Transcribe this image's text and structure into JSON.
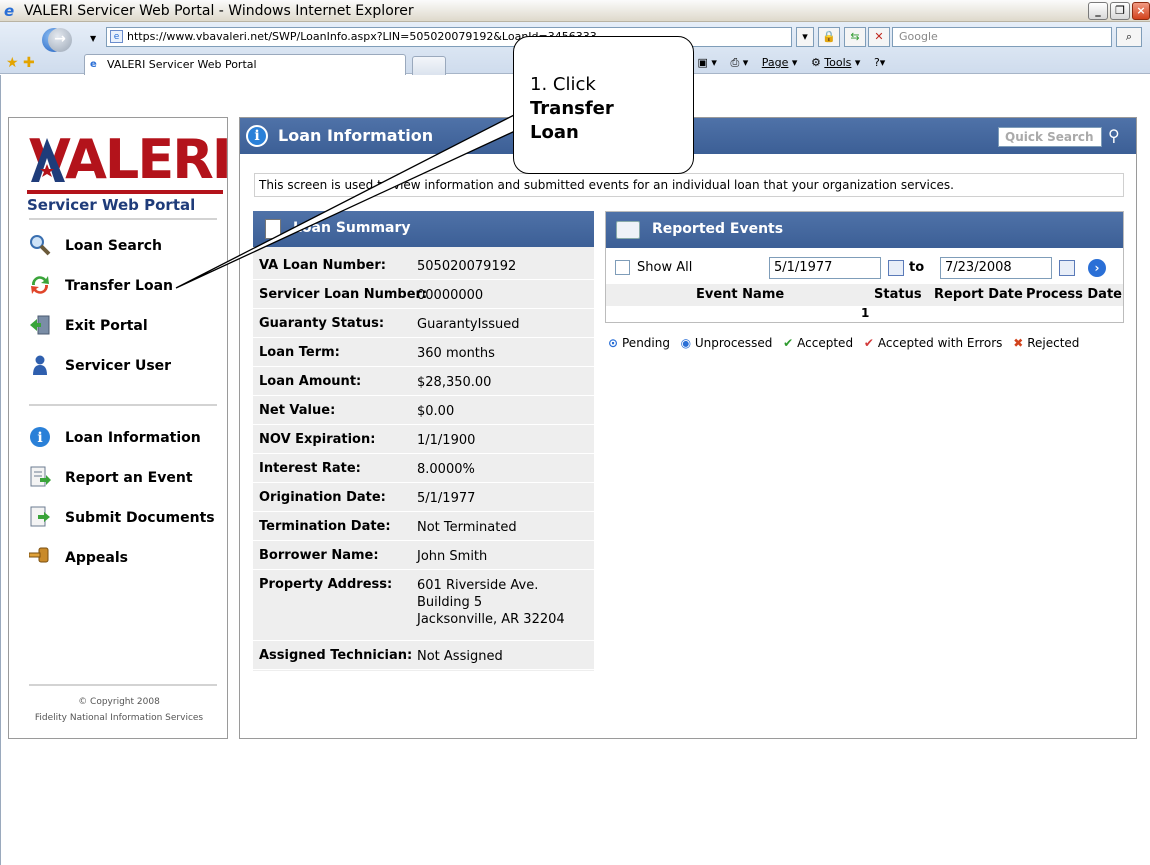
{
  "window": {
    "title": "VALERI Servicer Web Portal - Windows Internet Explorer",
    "url": "https://www.vbavaleri.net/SWP/LoanInfo.aspx?LIN=505020079192&LoanId=3456333",
    "search_placeholder": "Google",
    "tab_title": "VALERI Servicer Web Portal",
    "commands": {
      "page": "Page",
      "tools": "Tools"
    }
  },
  "logo": {
    "word": "VALERI",
    "subtitle": "Servicer Web Portal"
  },
  "nav": {
    "top_items": [
      {
        "label": "Loan Search",
        "icon": "magnifier-icon"
      },
      {
        "label": "Transfer Loan",
        "icon": "transfer-arrows-icon"
      },
      {
        "label": "Exit Portal",
        "icon": "exit-door-icon"
      },
      {
        "label": "Servicer User",
        "icon": "user-icon"
      }
    ],
    "bottom_items": [
      {
        "label": "Loan Information",
        "icon": "info-icon"
      },
      {
        "label": "Report an Event",
        "icon": "report-icon"
      },
      {
        "label": "Submit Documents",
        "icon": "document-icon"
      },
      {
        "label": "Appeals",
        "icon": "gavel-icon"
      }
    ]
  },
  "copyright": {
    "line1": "© Copyright 2008",
    "line2": "Fidelity National Information Services"
  },
  "main": {
    "title": "Loan Information",
    "quick_search_placeholder": "Quick Search",
    "description": "This screen is used to view information and submitted events for an individual loan that your organization services."
  },
  "summary": {
    "title": "Loan Summary",
    "rows": [
      {
        "label": "VA Loan Number:",
        "value": "505020079192"
      },
      {
        "label": "Servicer Loan Number:",
        "value": "00000000"
      },
      {
        "label": "Guaranty Status:",
        "value": "GuarantyIssued"
      },
      {
        "label": "Loan Term:",
        "value": "360 months"
      },
      {
        "label": "Loan Amount:",
        "value": "$28,350.00"
      },
      {
        "label": "Net Value:",
        "value": "$0.00"
      },
      {
        "label": "NOV Expiration:",
        "value": "1/1/1900"
      },
      {
        "label": "Interest Rate:",
        "value": "8.0000%"
      },
      {
        "label": "Origination Date:",
        "value": "5/1/1977"
      },
      {
        "label": "Termination Date:",
        "value": "Not Terminated"
      },
      {
        "label": "Borrower Name:",
        "value": "John Smith"
      },
      {
        "label": "Property Address:",
        "value": "601 Riverside Ave.",
        "value2": "Building 5",
        "value3": "Jacksonville, AR 32204"
      },
      {
        "label": "Assigned Technician:",
        "value": "Not Assigned"
      }
    ]
  },
  "events": {
    "title": "Reported Events",
    "show_all_label": "Show All",
    "from_date": "5/1/1977",
    "to_label": "to",
    "to_date": "7/23/2008",
    "columns": [
      "Event Name",
      "Status",
      "Report Date",
      "Process Date"
    ],
    "count": "1",
    "legend": [
      {
        "label": "Pending",
        "icon": "pending-icon",
        "color": "#2a6fd6"
      },
      {
        "label": "Unprocessed",
        "icon": "unprocessed-icon",
        "color": "#2a6fd6"
      },
      {
        "label": "Accepted",
        "icon": "checkmark-icon",
        "color": "#2e9a2e"
      },
      {
        "label": "Accepted with Errors",
        "icon": "checkmark-error-icon",
        "color": "#d23a3a"
      },
      {
        "label": "Rejected",
        "icon": "x-icon",
        "color": "#d2431d"
      }
    ]
  },
  "callout": {
    "step": "1. Click",
    "line2": "Transfer",
    "line3": "Loan"
  },
  "colors": {
    "brand_red": "#b3131b",
    "header_blue": "#3c5f96",
    "subtitle_blue": "#1f3c7a"
  }
}
